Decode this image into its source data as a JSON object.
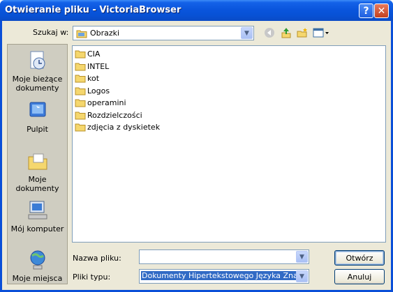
{
  "window": {
    "title": "Otwieranie pliku - VictoriaBrowser",
    "help_label": "?",
    "close_label": "✕"
  },
  "toolbar": {
    "look_in_label": "Szukaj w:",
    "look_in_value": "Obrazki",
    "icons": [
      "back-icon",
      "up-folder-icon",
      "new-folder-icon",
      "view-menu-icon"
    ]
  },
  "places": [
    {
      "label": "Moje bieżące dokumenty",
      "icon": "recent-documents-icon"
    },
    {
      "label": "Pulpit",
      "icon": "desktop-icon"
    },
    {
      "label": "Moje dokumenty",
      "icon": "my-documents-icon"
    },
    {
      "label": "Mój komputer",
      "icon": "my-computer-icon"
    },
    {
      "label": "Moje miejsca",
      "icon": "network-places-icon"
    }
  ],
  "files": [
    {
      "name": "CIA"
    },
    {
      "name": "INTEL"
    },
    {
      "name": "kot"
    },
    {
      "name": "Logos"
    },
    {
      "name": "operamini"
    },
    {
      "name": "Rozdzielczości"
    },
    {
      "name": "zdjęcia z dyskietek"
    }
  ],
  "filename": {
    "label": "Nazwa pliku:",
    "value": ""
  },
  "filetype": {
    "label": "Pliki typu:",
    "value": "Dokumenty Hipertekstowego Języka Znaczników"
  },
  "buttons": {
    "open": "Otwórz",
    "cancel": "Anuluj"
  },
  "colors": {
    "title_bar": "#0a55dd",
    "dialog_bg": "#ece9d8",
    "selection": "#316ac5"
  }
}
